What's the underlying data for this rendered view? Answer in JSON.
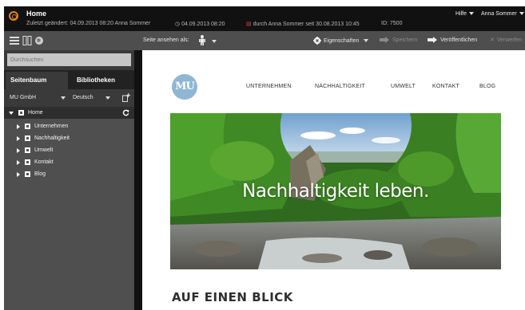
{
  "topbar": {
    "title": "Home",
    "changed": "Zuletzt geändert: 04.09.2013 08:20 Anna Sommer",
    "date": "04.09.2013 08:20",
    "lock_prefix": "▤",
    "lock_text": "durch Anna Sommer seit 30.08.2013 10:45",
    "id": "ID: 7500",
    "help": "Hilfe",
    "user": "Anna Sommer"
  },
  "toolbar": {
    "view_label": "Seite ansehen als:",
    "properties": "Eigenschaften",
    "save": "Speichern",
    "publish": "Veröffentlichen",
    "discard": "Verwerfen"
  },
  "sidebar": {
    "search_placeholder": "Durchsuchen",
    "tabs": [
      "Seitenbaum",
      "Bibliotheken"
    ],
    "site_select": "MU GmbH",
    "language_select": "Deutsch",
    "tree": {
      "root": "Home",
      "children": [
        "Unternehmen",
        "Nachhaltigkeit",
        "Umwelt",
        "Kontakt",
        "Blog"
      ]
    }
  },
  "site": {
    "logo": "MU",
    "nav": [
      "UNTERNEHMEN",
      "NACHHALTIGKEIT",
      "UMWELT",
      "KONTAKT",
      "BLOG"
    ],
    "hero_text": "Nachhaltigkeit leben.",
    "section_heading": "AUF EINEN BLICK"
  },
  "colors": {
    "accent_orange": "#e0821c",
    "toolbar": "#4e4e4e",
    "sidebar": "#3a3a3a",
    "logo_blue": "#8fb7d4"
  }
}
